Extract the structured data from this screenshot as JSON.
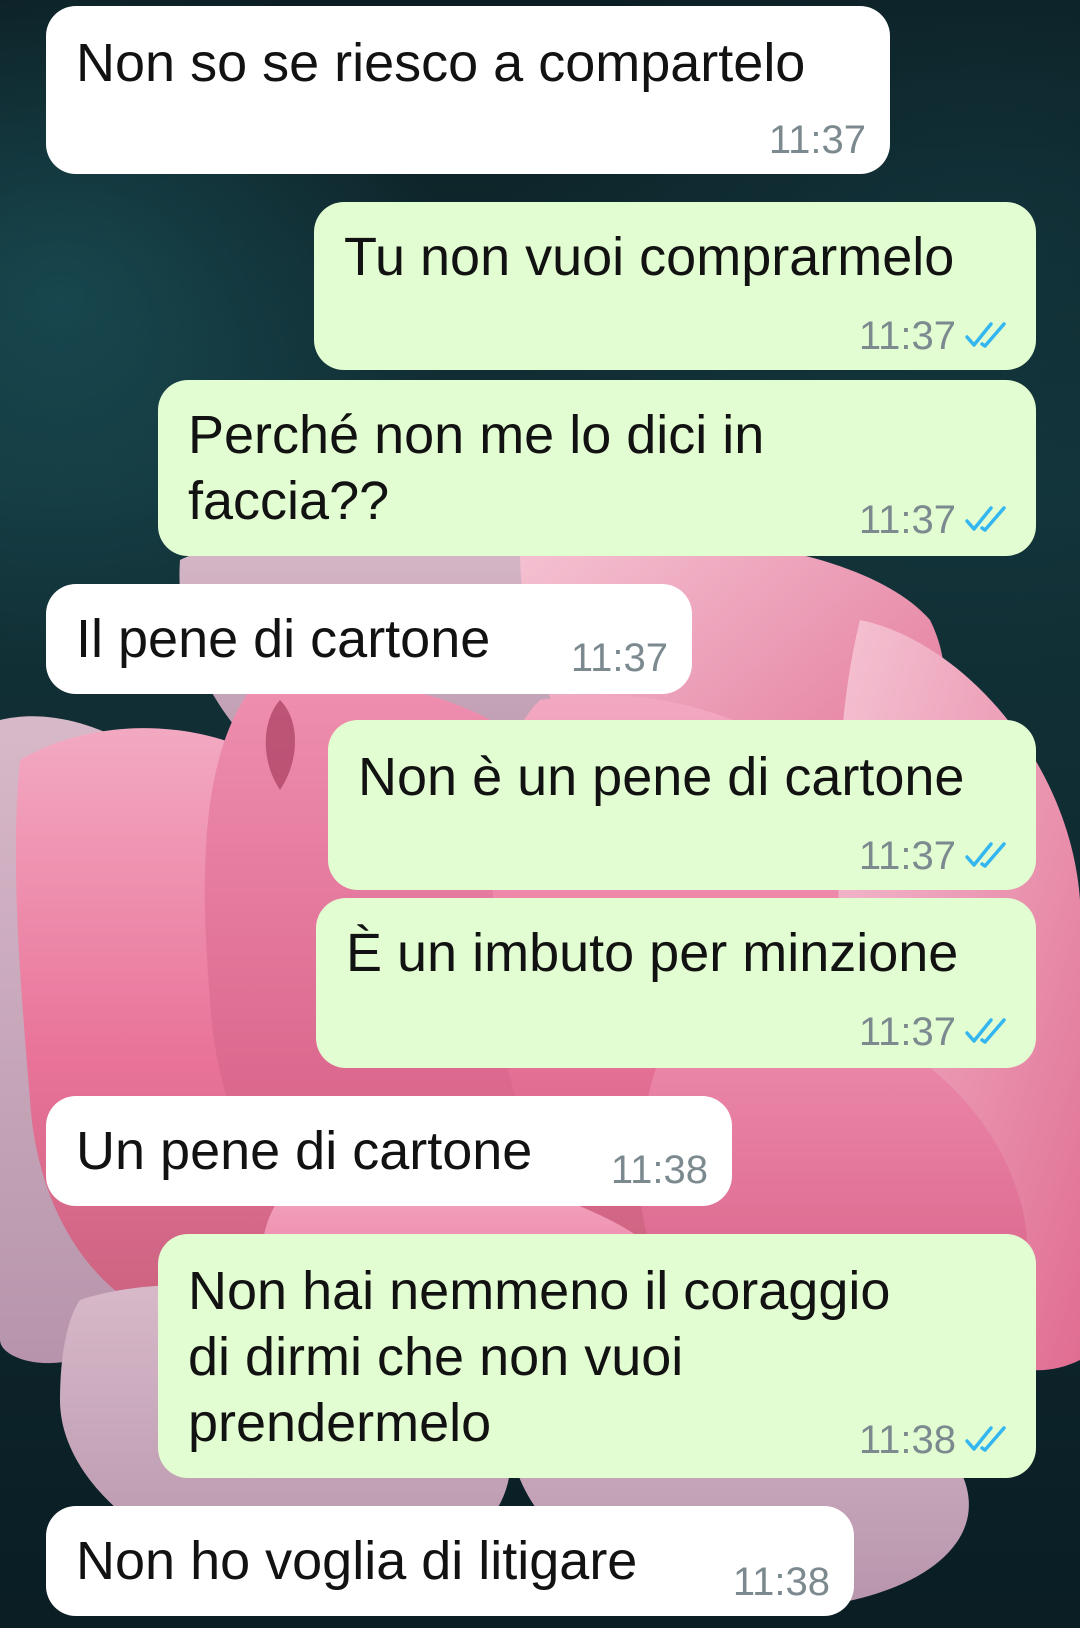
{
  "messages": [
    {
      "direction": "incoming",
      "text": "Non so se riesco a compartelo",
      "time": "11:37",
      "read": false
    },
    {
      "direction": "outgoing",
      "text": "Tu non vuoi comprarmelo",
      "time": "11:37",
      "read": true
    },
    {
      "direction": "outgoing",
      "text": "Perché non me lo dici in\nfaccia??",
      "time": "11:37",
      "read": true
    },
    {
      "direction": "incoming",
      "text": "Il pene di cartone",
      "time": "11:37",
      "read": false
    },
    {
      "direction": "outgoing",
      "text": "Non è un pene di cartone",
      "time": "11:37",
      "read": true
    },
    {
      "direction": "outgoing",
      "text": "È un imbuto per minzione",
      "time": "11:37",
      "read": true
    },
    {
      "direction": "incoming",
      "text": "Un pene di cartone",
      "time": "11:38",
      "read": false
    },
    {
      "direction": "outgoing",
      "text": "Non hai nemmeno il coraggio\ndi dirmi che non vuoi\nprendermelo",
      "time": "11:38",
      "read": true
    },
    {
      "direction": "incoming",
      "text": "Non ho voglia di litigare",
      "time": "11:38",
      "read": false
    }
  ],
  "icons": {
    "read_receipt": "double-check-icon"
  },
  "colors": {
    "incoming_bubble": "#ffffff",
    "outgoing_bubble": "#e2fdd1",
    "read_tick": "#34b7f1",
    "timestamp": "#7c8a8f"
  }
}
